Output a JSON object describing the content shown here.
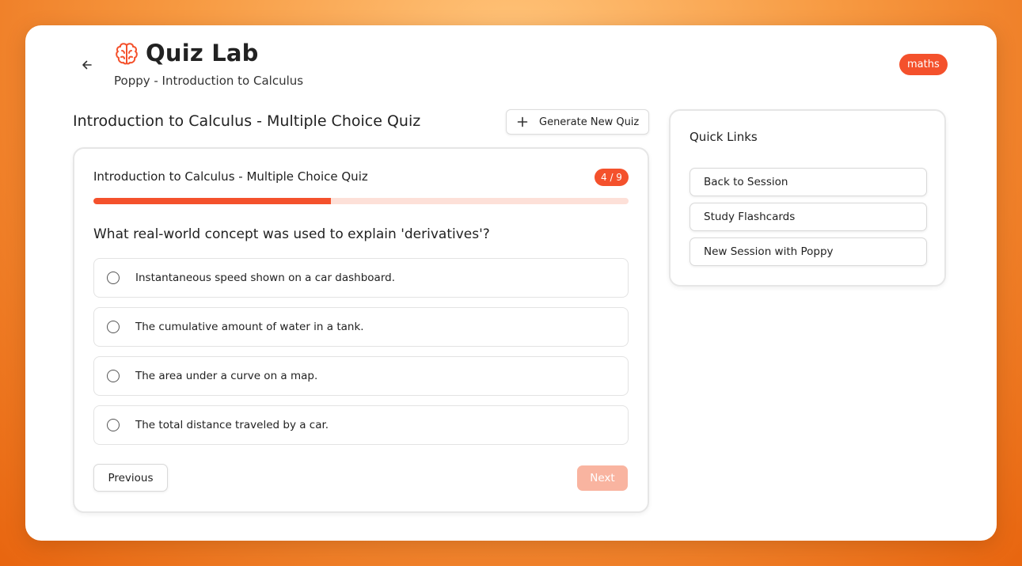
{
  "header": {
    "title": "Quiz Lab",
    "subtitle": "Poppy - Introduction to Calculus",
    "subject_badge": "maths",
    "back_icon": "arrow-left-icon",
    "logo_icon": "brain-icon"
  },
  "quiz": {
    "heading": "Introduction to Calculus - Multiple Choice Quiz",
    "generate_label": "Generate New Quiz",
    "card_title": "Introduction to Calculus - Multiple Choice Quiz",
    "progress_label": "4 / 9",
    "progress_fraction": 0.444,
    "question": "What real-world concept was used to explain 'derivatives'?",
    "options": [
      "Instantaneous speed shown on a car dashboard.",
      "The cumulative amount of water in a tank.",
      "The area under a curve on a map.",
      "The total distance traveled by a car."
    ],
    "previous_label": "Previous",
    "next_label": "Next"
  },
  "quick_links": {
    "title": "Quick Links",
    "items": [
      "Back to Session",
      "Study Flashcards",
      "New Session with Poppy"
    ]
  },
  "colors": {
    "accent": "#f4512c",
    "accent_light": "#fde0d8",
    "next_disabled": "#f9b4a0"
  }
}
